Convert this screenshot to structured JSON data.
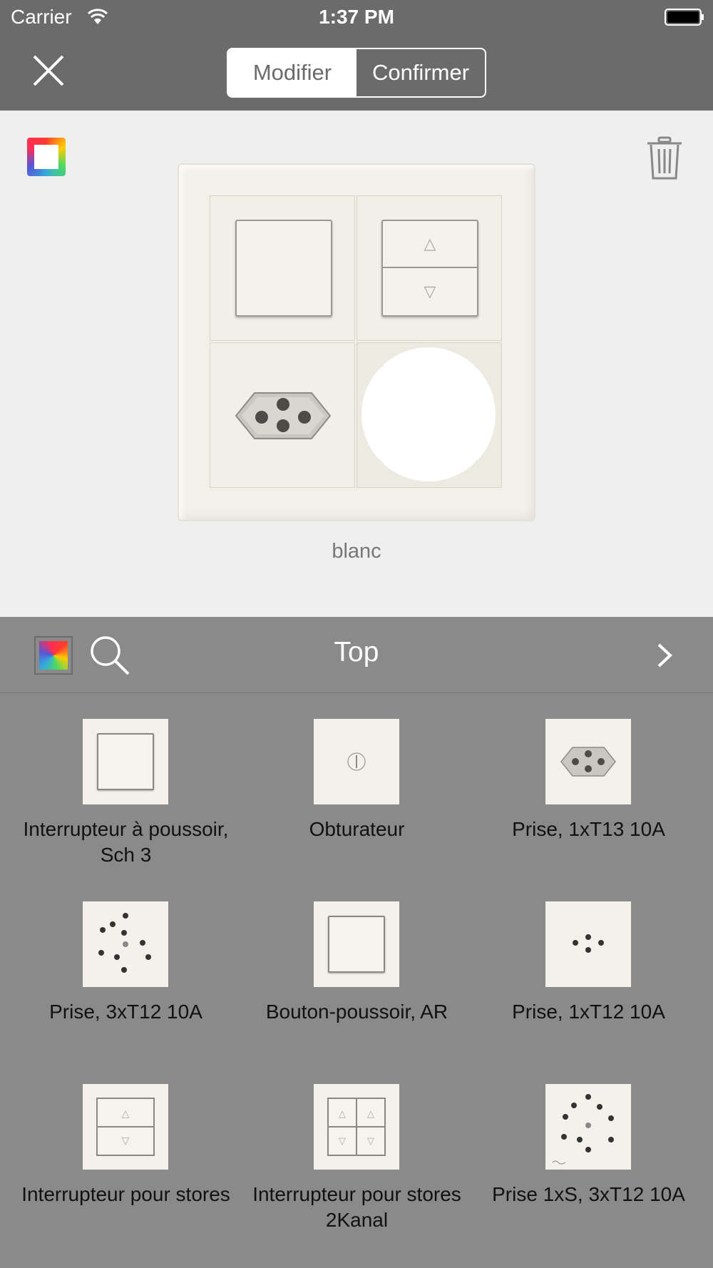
{
  "status_bar": {
    "carrier": "Carrier",
    "time": "1:37 PM"
  },
  "nav": {
    "close_icon": "close-icon",
    "segments": [
      {
        "label": "Modifier",
        "selected": true
      },
      {
        "label": "Confirmer",
        "selected": false
      }
    ]
  },
  "preview": {
    "color_picker_icon": "color-frame-icon",
    "trash_icon": "trash-icon",
    "caption": "blanc"
  },
  "toolbar": {
    "palette_icon": "palette-icon",
    "search_icon": "search-icon",
    "title": "Top",
    "next_icon": "chevron-right-icon"
  },
  "products": [
    {
      "label": "Interrupteur à poussoir, Sch 3",
      "icon": "rocker-switch"
    },
    {
      "label": "Obturateur",
      "icon": "blank-cover"
    },
    {
      "label": "Prise, 1xT13 10A",
      "icon": "socket-t13"
    },
    {
      "label": "Prise, 3xT12 10A",
      "icon": "socket-3xt12"
    },
    {
      "label": "Bouton-poussoir, AR",
      "icon": "push-button"
    },
    {
      "label": "Prise, 1xT12 10A",
      "icon": "socket-t12"
    },
    {
      "label": "Interrupteur pour stores",
      "icon": "blind-switch"
    },
    {
      "label": "Interrupteur pour stores 2Kanal",
      "icon": "blind-switch-2ch"
    },
    {
      "label": "Prise 1xS, 3xT12 10A",
      "icon": "socket-1xs-3xt12"
    }
  ],
  "colors": {
    "nav_bg": "#6b6b6b",
    "panel_bg": "#8a8a8a",
    "preview_bg": "#efefef",
    "plate": "#f2f0e8"
  }
}
